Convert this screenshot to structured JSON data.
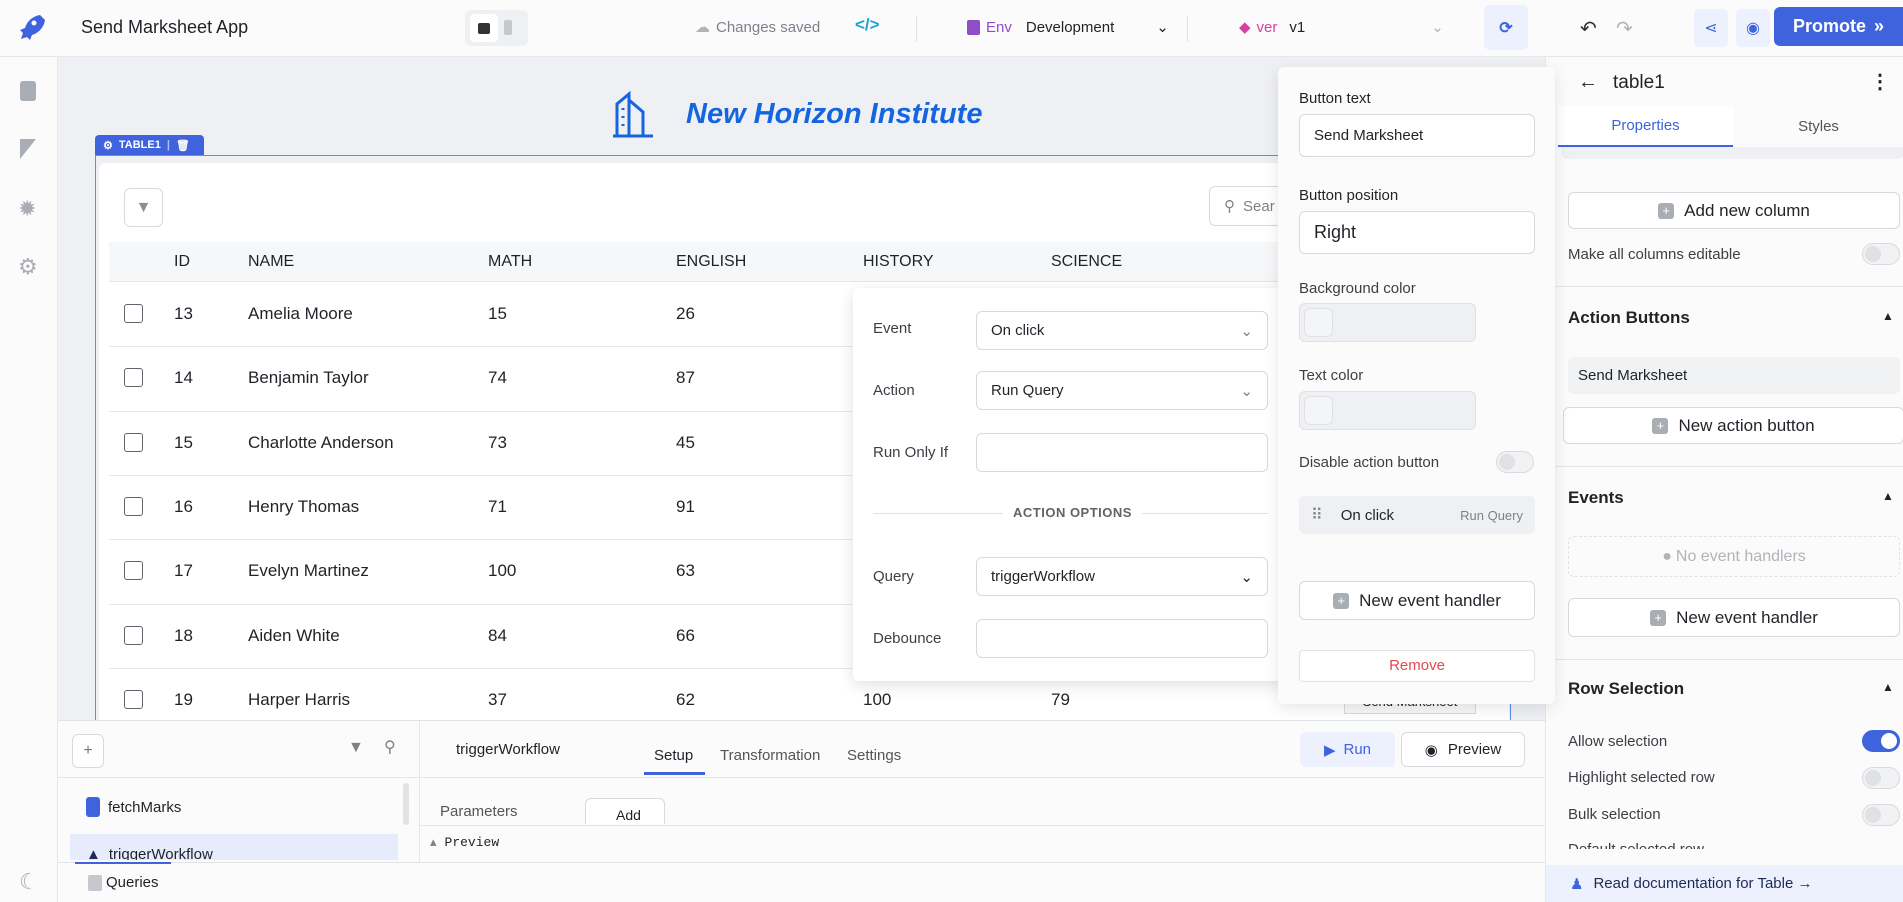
{
  "header": {
    "app_name": "Send Marksheet App",
    "save_status": "Changes saved",
    "env_label": "Env",
    "env_value": "Development",
    "version_label": "ver",
    "version_value": "v1",
    "promote_label": "Promote",
    "accent_color": "#3e63dd"
  },
  "rail": {
    "icons": [
      "pages-icon",
      "comments-icon",
      "debugger-icon",
      "settings-icon",
      "moon-icon"
    ]
  },
  "canvas": {
    "title": "New Horizon Institute",
    "component_tag": "TABLE1",
    "search_placeholder": "Sear",
    "table": {
      "columns": [
        "ID",
        "NAME",
        "MATH",
        "ENGLISH",
        "HISTORY",
        "SCIENCE"
      ],
      "rows": [
        [
          "13",
          "Amelia Moore",
          "15",
          "26",
          "",
          ""
        ],
        [
          "14",
          "Benjamin Taylor",
          "74",
          "87",
          "",
          ""
        ],
        [
          "15",
          "Charlotte Anderson",
          "73",
          "45",
          "",
          ""
        ],
        [
          "16",
          "Henry Thomas",
          "71",
          "91",
          "",
          ""
        ],
        [
          "17",
          "Evelyn Martinez",
          "100",
          "63",
          "",
          ""
        ],
        [
          "18",
          "Aiden White",
          "84",
          "66",
          "",
          ""
        ],
        [
          "19",
          "Harper Harris",
          "37",
          "62",
          "100",
          "79"
        ]
      ],
      "action_button": "Send Marksheet"
    }
  },
  "event_popover": {
    "event_label": "Event",
    "event_value": "On click",
    "action_label": "Action",
    "action_value": "Run Query",
    "run_only_if_label": "Run Only If",
    "run_only_if_value": "",
    "section": "ACTION OPTIONS",
    "query_label": "Query",
    "query_value": "triggerWorkflow",
    "debounce_label": "Debounce",
    "debounce_value": ""
  },
  "button_props": {
    "button_text_label": "Button text",
    "button_text_value": "Send Marksheet",
    "position_label": "Button position",
    "position_value": "Right",
    "bg_color_label": "Background color",
    "text_color_label": "Text color",
    "disable_label": "Disable action button",
    "handler_event": "On click",
    "handler_action": "Run Query",
    "new_handler": "New event handler",
    "remove": "Remove"
  },
  "inspector": {
    "component": "table1",
    "tabs": [
      "Properties",
      "Styles"
    ],
    "add_column": "Add new column",
    "make_editable": "Make all columns editable",
    "action_buttons_title": "Action Buttons",
    "action_buttons": [
      "Send Marksheet"
    ],
    "new_action_button": "New action button",
    "events_title": "Events",
    "no_events": "No event handlers",
    "new_event_handler": "New event handler",
    "row_selection_title": "Row Selection",
    "allow_selection": "Allow selection",
    "highlight_row": "Highlight selected row",
    "bulk_selection": "Bulk selection",
    "default_row": "Default selected row",
    "docs_link": "Read documentation for Table →"
  },
  "query_panel": {
    "queries": [
      "fetchMarks",
      "triggerWorkflow"
    ],
    "active_query": "triggerWorkflow",
    "tabs": [
      "Setup",
      "Transformation",
      "Settings"
    ],
    "run": "Run",
    "preview": "Preview",
    "parameters": "Parameters",
    "add": "Add",
    "preview_section": "Preview",
    "footer_tab": "Queries"
  }
}
